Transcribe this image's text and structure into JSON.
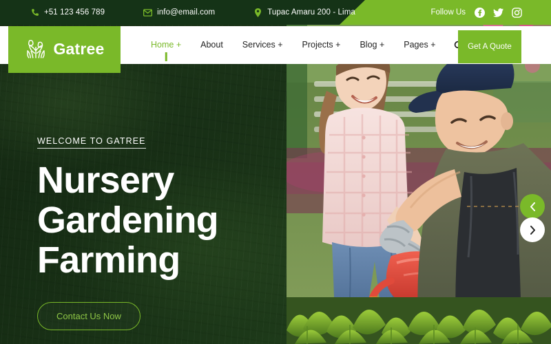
{
  "topbar": {
    "phone": "+51 123 456 789",
    "email": "info@email.com",
    "address": "Tupac Amaru 200 - Lima",
    "follow_label": "Follow Us",
    "socials": [
      {
        "name": "facebook",
        "label": "Facebook"
      },
      {
        "name": "twitter",
        "label": "Twitter"
      },
      {
        "name": "instagram",
        "label": "Instagram"
      }
    ],
    "bg_dark": "#153317",
    "bg_light": "#7ab929"
  },
  "brand": {
    "name": "Gatree",
    "logo_icon": "grass-plant-icon",
    "color": "#7ab929"
  },
  "nav": {
    "items": [
      {
        "label": "Home",
        "has_dropdown": true,
        "active": true
      },
      {
        "label": "About",
        "has_dropdown": false,
        "active": false
      },
      {
        "label": "Services",
        "has_dropdown": true,
        "active": false
      },
      {
        "label": "Projects",
        "has_dropdown": true,
        "active": false
      },
      {
        "label": "Blog",
        "has_dropdown": true,
        "active": false
      },
      {
        "label": "Pages",
        "has_dropdown": true,
        "active": false
      }
    ],
    "search_icon": "search-icon",
    "quote_label": "Get A Quote"
  },
  "hero": {
    "eyebrow": "WELCOME TO GATREE",
    "headline_line1": "Nursery",
    "headline_line2": "Gardening",
    "headline_line3": "Farming",
    "cta_label": "Contact Us Now",
    "prev_label": "Previous slide",
    "next_label": "Next slide",
    "accent": "#7ab929",
    "overlay": "#1c3419"
  }
}
